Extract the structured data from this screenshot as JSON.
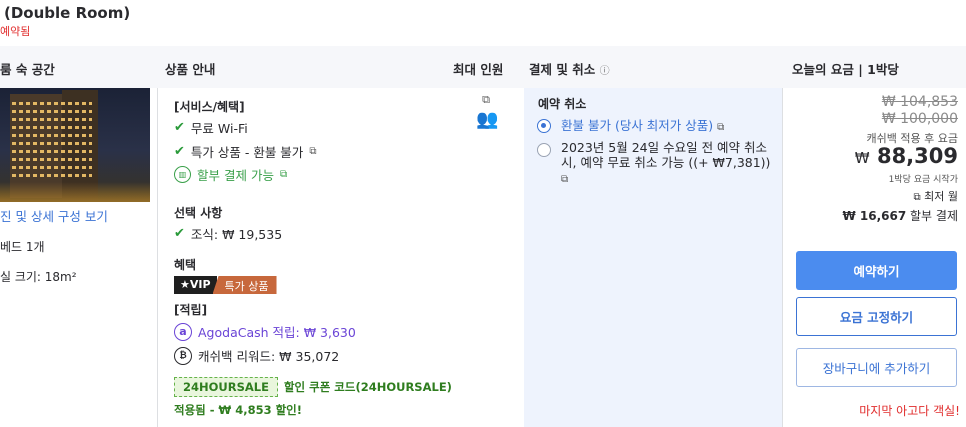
{
  "room": {
    "title": "(Double Room)",
    "status": "예약됨"
  },
  "headers": {
    "room": "룸 숙 공간",
    "product": "상품 안내",
    "max_guests": "최대 인원",
    "payment": "결제 및 취소",
    "payment_info_icon": "ⓘ",
    "price": "오늘의 요금 | 1박당"
  },
  "left": {
    "photos_link": "진 및 상세 구성 보기",
    "bed": "베드 1개",
    "size": "실 크기: 18m²"
  },
  "benefits": {
    "services_title": "[서비스/혜택]",
    "items": [
      "무료 Wi-Fi",
      "특가 상품 - 환불 불가"
    ],
    "installment": "할부 결제 가능",
    "options_title": "선택 사항",
    "breakfast": "조식: ₩ 19,535",
    "perks_title": "혜택",
    "vip_tag": "★VIP",
    "special_tag": "특가 상품",
    "points_title": "[적립]",
    "agoda_cash": "AgodaCash 적립: ₩ 3,630",
    "cashback": "캐쉬백 리워드: ₩ 35,072",
    "coupon_code": "24HOURSALE",
    "coupon_desc": "할인 쿠폰 코드(24HOURSALE)",
    "applied": "적용됨 - ₩ 4,853 할인!"
  },
  "cancel": {
    "title": "예약 취소",
    "option1": "환불 불가 (당사 최저가 상품)",
    "option2": "2023년 5월 24일 수요일 전 예약 취소 시, 예약 무료 취소 가능 ((+ ₩7,381))"
  },
  "price": {
    "original1": "₩ 104,853",
    "original2": "₩ 100,000",
    "cashback_note": "캐쉬백 적용 후 요금",
    "currency": "₩",
    "final": "88,309",
    "per_night": "1박당 요금 시작가",
    "min_month": "최저 월",
    "installment": "₩ 16,667",
    "installment_suffix": "할부 결제"
  },
  "buttons": {
    "book": "예약하기",
    "lock_price": "요금 고정하기",
    "add_cart": "장바구니에 추가하기"
  },
  "last_chance": "마지막 아고다 객실!"
}
